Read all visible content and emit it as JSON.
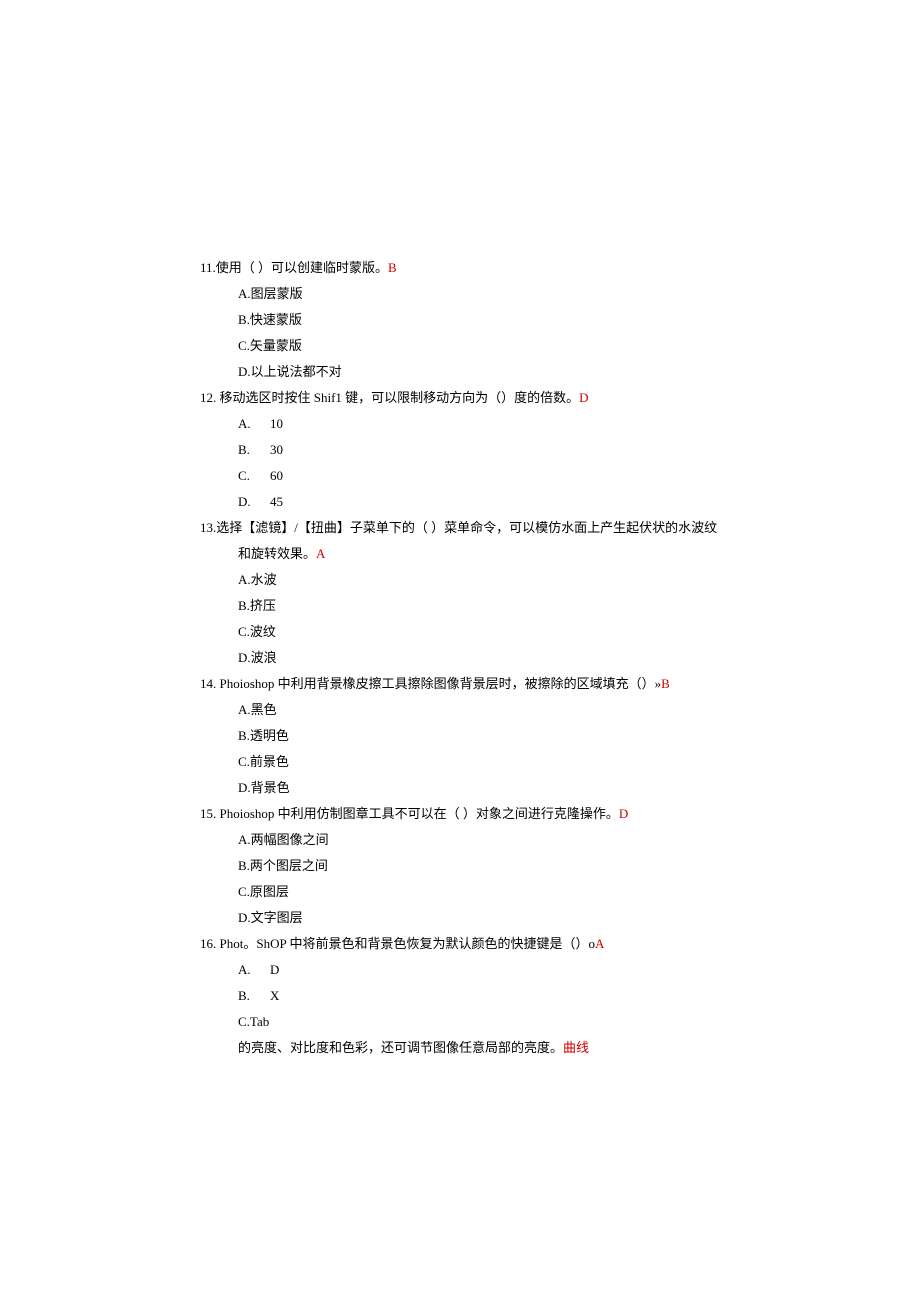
{
  "q11": {
    "num": "11.",
    "text": "使用（ ）可以创建临时蒙版。",
    "ans": "B",
    "opts": {
      "A": "A.图层蒙版",
      "B": "B.快速蒙版",
      "C": "C.矢量蒙版",
      "D": "D.以上说法都不对"
    }
  },
  "q12": {
    "num": "12.",
    "text": " 移动选区时按住 Shif1 键，可以限制移动方向为（）度的倍数。",
    "ans": "D",
    "opts": {
      "A": {
        "letter": "A.",
        "val": "10"
      },
      "B": {
        "letter": "B.",
        "val": "30"
      },
      "C": {
        "letter": "C.",
        "val": "60"
      },
      "D": {
        "letter": "D.",
        "val": "45"
      }
    }
  },
  "q13": {
    "num": "13.",
    "text": "选择【滤镜】/【扭曲】子菜单下的（ ）菜单命令，可以模仿水面上产生起伏状的水波纹",
    "cont": "和旋转效果。",
    "ans": "A",
    "opts": {
      "A": "A.水波",
      "B": "B.挤压",
      "C": "C.波纹",
      "D": "D.波浪"
    }
  },
  "q14": {
    "num": "14.",
    "text": " Phoioshop 中利用背景橡皮擦工具擦除图像背景层时，被擦除的区域填充（）»",
    "ans": "B",
    "opts": {
      "A": "A.黑色",
      "B": "B.透明色",
      "C": "C.前景色",
      "D": "D.背景色"
    }
  },
  "q15": {
    "num": "15.",
    "text": " Phoioshop 中利用仿制图章工具不可以在（ ）对象之间进行克隆操作。",
    "ans": "D",
    "opts": {
      "A": "A.两幅图像之间",
      "B": "B.两个图层之间",
      "C": "C.原图层",
      "D": "D.文字图层"
    }
  },
  "q16": {
    "num": "16.",
    "text": " Phot。ShOP 中将前景色和背景色恢复为默认颜色的快捷键是（）o",
    "ans": "A",
    "opts": {
      "A": {
        "letter": "A.",
        "val": "D"
      },
      "B": {
        "letter": "B.",
        "val": "X"
      },
      "C": "C.Tab"
    },
    "trail": {
      "pre": " 的亮度、对比度和色彩，还可调节图像任意局部的亮度。",
      "red": "曲线"
    }
  }
}
